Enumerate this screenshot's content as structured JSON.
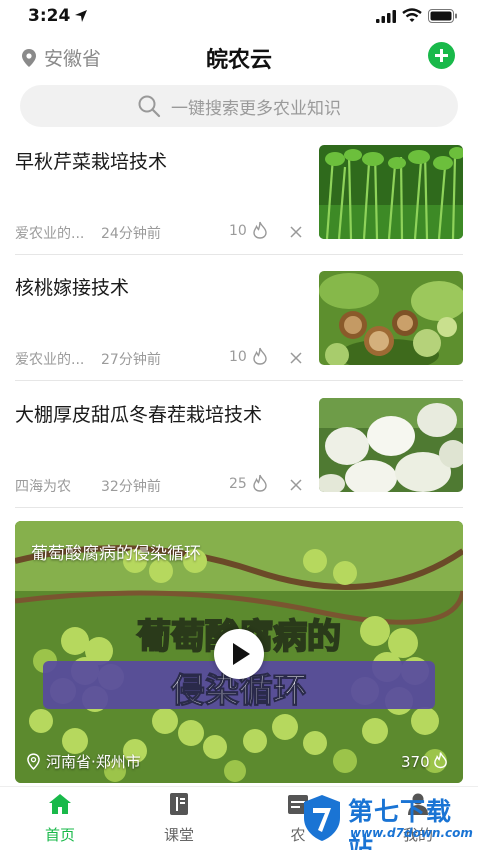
{
  "status_bar": {
    "time": "3:24"
  },
  "header": {
    "location": "安徽省",
    "title": "皖农云"
  },
  "search": {
    "placeholder": "一键搜索更多农业知识"
  },
  "articles": [
    {
      "title": "早秋芹菜栽培技术",
      "source": "爱农业的...",
      "time": "24分钟前",
      "count": "10",
      "thumb": "celery"
    },
    {
      "title": "核桃嫁接技术",
      "source": "爱农业的...",
      "time": "27分钟前",
      "count": "10",
      "thumb": "walnut"
    },
    {
      "title": "大棚厚皮甜瓜冬春茬栽培技术",
      "source": "四海为农",
      "time": "32分钟前",
      "count": "25",
      "thumb": "melon"
    }
  ],
  "video": {
    "title": "葡萄酸腐病的侵染循环",
    "overlay_line1": "葡萄酸腐病的",
    "overlay_line2": "侵染循环",
    "location": "河南省·郑州市",
    "count": "370"
  },
  "tabs": [
    {
      "label": "首页",
      "icon": "home-icon",
      "active": true
    },
    {
      "label": "课堂",
      "icon": "book-icon",
      "active": false
    },
    {
      "label": "农",
      "icon": "calendar-icon",
      "active": false
    },
    {
      "label": "我的",
      "icon": "user-icon",
      "active": false
    }
  ],
  "watermark": {
    "text": "第七下载站",
    "url": "www.d7down.com"
  },
  "colors": {
    "accent": "#19b94a",
    "muted": "#9b9b9b",
    "watermark": "#1a74d4"
  }
}
